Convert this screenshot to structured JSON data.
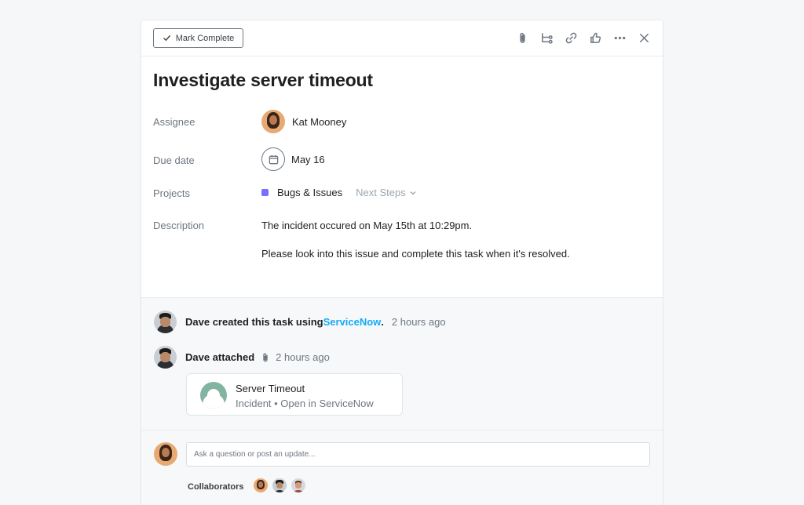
{
  "toolbar": {
    "mark_complete_label": "Mark Complete",
    "icons": [
      "attachment-icon",
      "subtask-icon",
      "link-icon",
      "like-icon",
      "more-icon",
      "close-icon"
    ]
  },
  "task": {
    "title": "Investigate server timeout",
    "fields": {
      "assignee_label": "Assignee",
      "assignee_name": "Kat Mooney",
      "due_label": "Due date",
      "due_value": "May 16",
      "projects_label": "Projects",
      "project_name": "Bugs & Issues",
      "project_color": "#796eff",
      "project_section": "Next Steps",
      "description_label": "Description"
    },
    "description": [
      "The incident occured on May 15th at 10:29pm.",
      "Please look into this issue and complete this task when it's resolved."
    ]
  },
  "activity": {
    "created": {
      "actor_text": "Dave created this task using ",
      "link": "ServiceNow",
      "period": ".",
      "time": "2 hours ago"
    },
    "attached": {
      "actor_text": "Dave attached",
      "time": "2 hours ago"
    },
    "attachment": {
      "title": "Server Timeout",
      "subtitle": "Incident • Open in ServiceNow",
      "logo_color": "#81b5a1"
    }
  },
  "composer": {
    "placeholder": "Ask a question or post an update...",
    "collaborators_label": "Collaborators"
  },
  "colors": {
    "link": "#14aaf5",
    "label": "#6f7782",
    "background": "#f6f7f8"
  }
}
